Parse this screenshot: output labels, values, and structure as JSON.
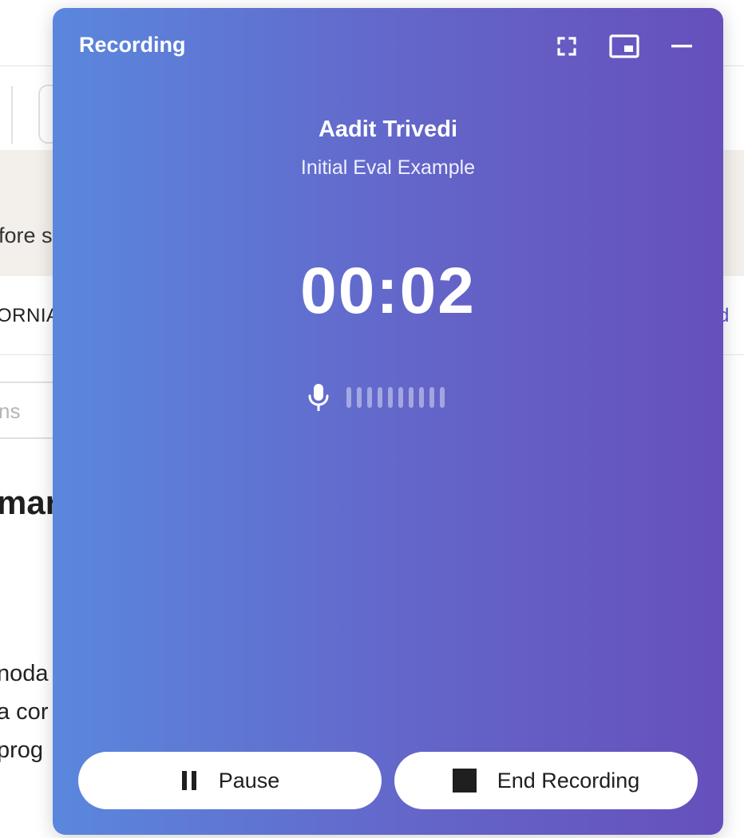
{
  "background": {
    "banner_text": "fore s",
    "row_text": "ORNIA",
    "row_link": "d",
    "search_placeholder": "ns",
    "heading": "mar",
    "lines": [
      "noda",
      "a cor",
      "prog"
    ]
  },
  "recorder": {
    "title": "Recording",
    "window_controls": {
      "fullscreen_icon": "fullscreen-icon",
      "pip_icon": "picture-in-picture-icon",
      "minimize_icon": "minimize-icon"
    },
    "patient_name": "Aadit Trivedi",
    "session_name": "Initial Eval Example",
    "elapsed_time": "00:02",
    "audio_level": {
      "icon": "microphone-icon",
      "bars_total": 10,
      "bars_active": 0
    },
    "pause_button": {
      "label": "Pause",
      "icon": "pause-icon"
    },
    "end_button": {
      "label": "End Recording",
      "icon": "stop-icon"
    }
  },
  "colors": {
    "gradient_start": "#5a87dd",
    "gradient_end": "#6650bb",
    "button_bg": "#ffffff",
    "text_on_accent": "#ffffff"
  }
}
